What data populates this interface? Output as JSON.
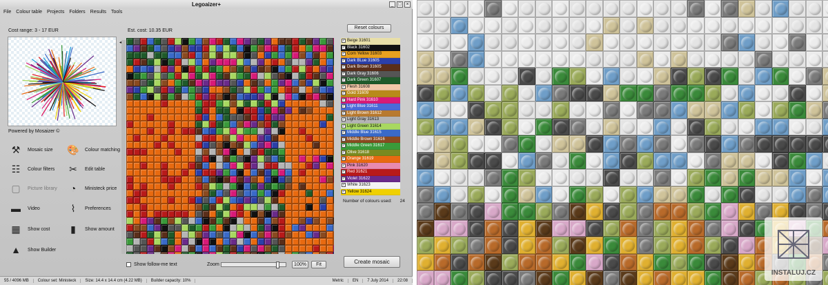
{
  "window": {
    "title": "Legoaizer+",
    "controls": [
      "_",
      "□",
      "×"
    ]
  },
  "menu": [
    "File",
    "Colour table",
    "Projects",
    "Folders",
    "Results",
    "Tools"
  ],
  "cost_range": "Cost range: 3 - 17 EUR",
  "est_cost": "Est. cost: 10.35 EUR",
  "powered_by": "Powered by Mosaizer ©",
  "reset_colours": "Reset colours",
  "tools": [
    {
      "label": "Mosaic size",
      "icon": "tools-icon"
    },
    {
      "label": "Colour matching",
      "icon": "palette-icon"
    },
    {
      "label": "Colour filters",
      "icon": "sliders-icon"
    },
    {
      "label": "Edit table",
      "icon": "scissors-icon"
    },
    {
      "label": "Picture library",
      "icon": "picture-library-icon"
    },
    {
      "label": "Ministeck price",
      "icon": "gauge-icon"
    },
    {
      "label": "Video",
      "icon": "video-icon"
    },
    {
      "label": "Preferences",
      "icon": "graph-icon"
    },
    {
      "label": "Show cost",
      "icon": "calculator-icon"
    },
    {
      "label": "Show amount",
      "icon": "bar-chart-icon"
    },
    {
      "label": "Show Builder",
      "icon": "cone-icon"
    }
  ],
  "colours": [
    {
      "label": "Beige 31601",
      "color": "#e8dfa8"
    },
    {
      "label": "Black 31602",
      "color": "#111111"
    },
    {
      "label": "Corn Yellow 31603",
      "color": "#e8a020"
    },
    {
      "label": "Dark BLue 31605",
      "color": "#2b3fa8"
    },
    {
      "label": "Dark Brown 31605",
      "color": "#5a2e1a"
    },
    {
      "label": "Dark Gray 31606",
      "color": "#555555"
    },
    {
      "label": "Dark Green 31607",
      "color": "#1f5a2a"
    },
    {
      "label": "Flesh 31608",
      "color": "#f2c8a8"
    },
    {
      "label": "Gold 31609",
      "color": "#b88a1a"
    },
    {
      "label": "Hard Pink 31610",
      "color": "#d81a78"
    },
    {
      "label": "Light Blue 31611",
      "color": "#4a6ad8"
    },
    {
      "label": "Light Brown 31612",
      "color": "#b87a30"
    },
    {
      "label": "Light Gray 31613",
      "color": "#b5b5b5"
    },
    {
      "label": "Light Green 31614",
      "color": "#a8d860"
    },
    {
      "label": "Middle Blue 31615",
      "color": "#3a6ac8"
    },
    {
      "label": "Middle Brown 31616",
      "color": "#8a4a20"
    },
    {
      "label": "Middle Green 31617",
      "color": "#3a9a3a"
    },
    {
      "label": "Olive 31618",
      "color": "#7a8a20"
    },
    {
      "label": "Orange 31619",
      "color": "#e86a10"
    },
    {
      "label": "Pink 31620",
      "color": "#e88ab0"
    },
    {
      "label": "Red 31621",
      "color": "#b81a1a"
    },
    {
      "label": "Violet 31622",
      "color": "#6a2a8a"
    },
    {
      "label": "White 31623",
      "color": "#f4f4f4"
    },
    {
      "label": "Yellow 31624",
      "color": "#f0d000"
    }
  ],
  "number_of_colours": {
    "label": "Number of colours used:",
    "value": "24"
  },
  "show_follow": "Show follow-me text",
  "zoom": {
    "label": "Zoom",
    "percent": "100%",
    "fit": "Fit",
    "level": 0.9
  },
  "create_mosaic": "Create mosaic",
  "status": {
    "memory": "55 / 4096 MB",
    "colour_set": "Colour set: Ministeck",
    "size": "Size: 14.4 x 14.4 cm (4.22 MB)",
    "builder": "Builder capacity: 10%",
    "units": "Metric",
    "flag": "EN",
    "date": "7 July 2014",
    "time": "22:08"
  },
  "watermark": "INSTALUJ.CZ",
  "mosaic_palette": [
    "#e86a10",
    "#b81a1a",
    "#6a2a8a",
    "#3a6ac8",
    "#2b3fa8",
    "#3a9a3a",
    "#1f5a2a",
    "#555555",
    "#111111",
    "#d81a78",
    "#8a4a20",
    "#b5b5b5",
    "#a8d860",
    "#5a2e1a"
  ],
  "lego_palette": [
    "#ececec",
    "#e4e4e4",
    "#cfc39a",
    "#6f9ec8",
    "#7a7a7a",
    "#9aaa5a",
    "#4a4a4a",
    "#3a8a3a",
    "#b86a2a",
    "#d8a8c8",
    "#e0b030",
    "#5a3a1a"
  ]
}
